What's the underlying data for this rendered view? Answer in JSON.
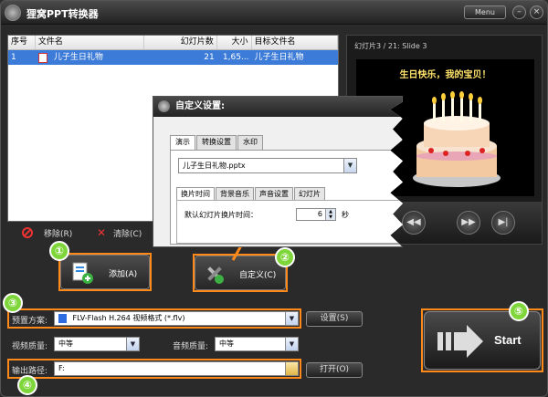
{
  "window": {
    "title": "狸窝PPT转换器",
    "menu_label": "Menu",
    "minimize_label": "–",
    "close_label": "×"
  },
  "file_list": {
    "headers": [
      "序号",
      "文件名",
      "幻灯片数",
      "大小",
      "目标文件名"
    ],
    "rows": [
      {
        "index": "1",
        "name": "儿子生日礼物",
        "slides": "21",
        "size": "1,65...",
        "target": "儿子生日礼物"
      }
    ],
    "remove_label": "移除(R)",
    "clear_label": "清除(C)"
  },
  "preview": {
    "title": "幻灯片3 / 21: Slide 3",
    "slide_caption": "生日快乐，我的宝贝！",
    "prev_icon": "◀◀",
    "next_icon": "▶▶",
    "end_icon": "▶|"
  },
  "buttons": {
    "add_label": "添加(A)",
    "custom_label": "自定义(C)",
    "settings_label": "设置(S)",
    "open_label": "打开(O)",
    "start_label": "Start"
  },
  "dialog": {
    "title": "自定义设置:",
    "tabs": [
      "演示",
      "转换设置",
      "水印"
    ],
    "file_select": "儿子生日礼物.pptx",
    "subtabs": [
      "换片时间",
      "背景音乐",
      "声音设置",
      "幻灯片"
    ],
    "default_time_label": "默认幻灯片换片时间：",
    "default_time_value": "6",
    "unit_label": "秒"
  },
  "output": {
    "preset_label": "预置方案:",
    "preset_value": "FLV-Flash H.264 视频格式 (*.flv)",
    "video_quality_label": "视频质量:",
    "video_quality_value": "中等",
    "audio_quality_label": "音频质量:",
    "audio_quality_value": "中等",
    "path_label": "输出路径:",
    "path_value": "F:"
  },
  "badges": [
    "①",
    "②",
    "③",
    "④",
    "⑤"
  ],
  "colors": {
    "highlight": "#ff8a1a",
    "badge": "#7ed63a",
    "selection": "#3d7bd8"
  }
}
